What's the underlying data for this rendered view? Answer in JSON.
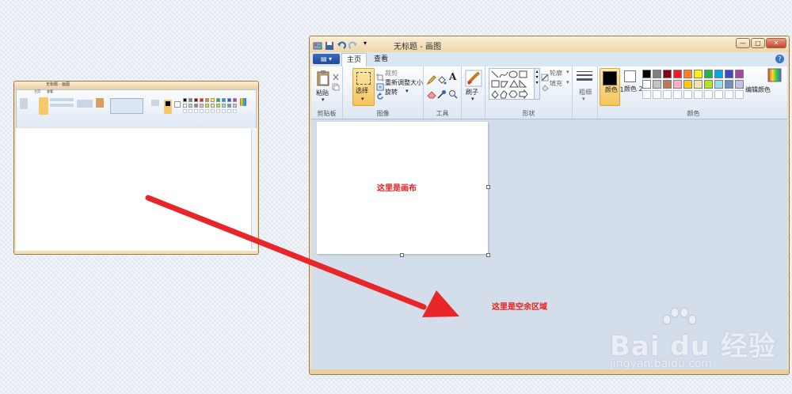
{
  "window": {
    "title": "无标题 - 画图",
    "min_glyph": "—",
    "max_glyph": "□",
    "close_glyph": "✕"
  },
  "tabs": {
    "file": "▤ ▾",
    "home": "主页",
    "view": "查看",
    "help": "?"
  },
  "ribbon": {
    "clipboard": {
      "paste": "粘贴",
      "label": "剪贴板"
    },
    "image": {
      "select": "选择",
      "crop": "裁剪",
      "resize": "重新调整大小",
      "rotate": "旋转",
      "label": "图像"
    },
    "tools": {
      "text_tool": "A",
      "label": "工具"
    },
    "brushes": {
      "label": "刷子"
    },
    "shapes": {
      "outline": "轮廓",
      "fill": "填充",
      "label": "形状"
    },
    "size": {
      "label": "粗细"
    },
    "colors": {
      "color1": "颜色 1",
      "color2": "颜色 2",
      "edit": "编辑颜色",
      "label": "颜色",
      "color1_value": "#000000",
      "color2_value": "#ffffff",
      "palette_row1": [
        "#000000",
        "#7f7f7f",
        "#880015",
        "#ed1c24",
        "#ff7f27",
        "#fff200",
        "#22b14c",
        "#00a2e8",
        "#3f48cc",
        "#a349a4"
      ],
      "palette_row2": [
        "#ffffff",
        "#c3c3c3",
        "#b97a57",
        "#ffaec9",
        "#ffc90e",
        "#efe4b0",
        "#b5e61d",
        "#99d9ea",
        "#7092be",
        "#c8bfe7"
      ]
    }
  },
  "canvas": {
    "annotation": "这里是画布"
  },
  "workspace": {
    "annotation": "这里是空余区域"
  },
  "watermark": {
    "brand": "Bai du 经验",
    "url": "jingyan.baidu.com"
  },
  "arrow_color": "#e8262a"
}
